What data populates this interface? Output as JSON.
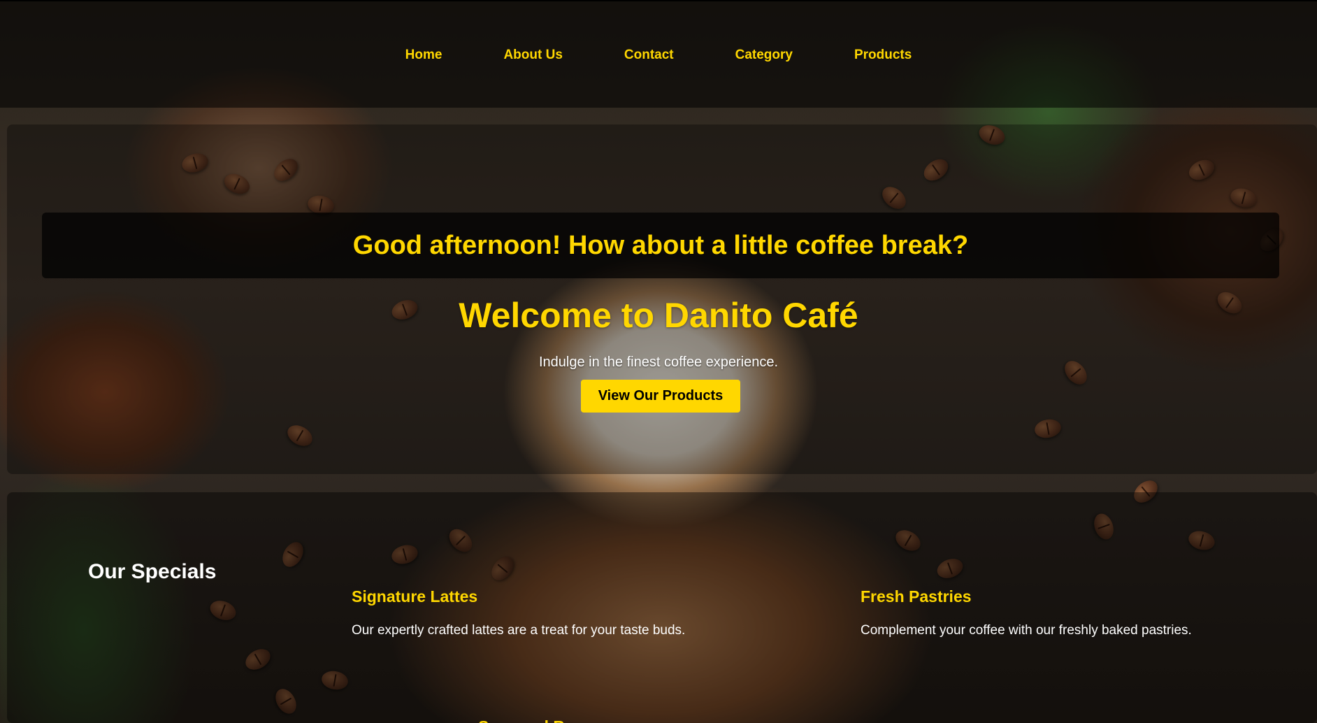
{
  "nav": {
    "items": [
      {
        "label": "Home"
      },
      {
        "label": "About Us"
      },
      {
        "label": "Contact"
      },
      {
        "label": "Category"
      },
      {
        "label": "Products"
      }
    ]
  },
  "hero": {
    "greeting": "Good afternoon! How about a little coffee break?",
    "title": "Welcome to Danito Café",
    "tagline": "Indulge in the finest coffee experience.",
    "cta_label": "View Our Products"
  },
  "specials": {
    "title": "Our Specials",
    "items": [
      {
        "title": "Signature Lattes",
        "description": "Our expertly crafted lattes are a treat for your taste buds."
      },
      {
        "title": "Fresh Pastries",
        "description": "Complement your coffee with our freshly baked pastries."
      },
      {
        "title": "Seasonal B"
      }
    ]
  },
  "colors": {
    "accent": "#ffd700",
    "text_light": "#ffffff",
    "overlay": "#000000"
  }
}
